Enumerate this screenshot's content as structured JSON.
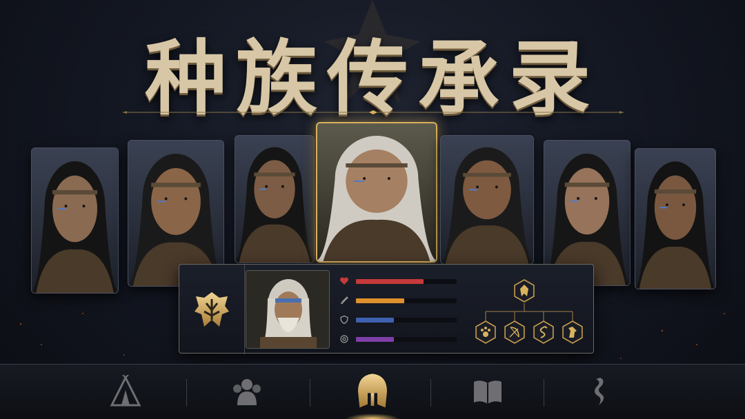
{
  "title": "种族传承录",
  "colors": {
    "gold": "#d9b25e",
    "health": "#c53a3a",
    "attack": "#e0902e",
    "defense": "#3f62b0",
    "magic": "#7e3fa6"
  },
  "portraits": [
    {
      "id": "warrior-woman-1",
      "selected": false
    },
    {
      "id": "warrior-man-topknot",
      "selected": false
    },
    {
      "id": "warrior-woman-braids",
      "selected": false
    },
    {
      "id": "elder-chieftain",
      "selected": true
    },
    {
      "id": "warrior-man-headband",
      "selected": false
    },
    {
      "id": "warrior-woman-jewels",
      "selected": false
    },
    {
      "id": "warrior-man-young",
      "selected": false
    }
  ],
  "stats": [
    {
      "icon": "heart-icon",
      "value": 0.67,
      "color": "#c53a3a"
    },
    {
      "icon": "sword-icon",
      "value": 0.48,
      "color": "#e0902e"
    },
    {
      "icon": "shield-icon",
      "value": 0.38,
      "color": "#3f62b0"
    },
    {
      "icon": "swirl-icon",
      "value": 0.38,
      "color": "#7e3fa6"
    }
  ],
  "skill_tree": {
    "root_icon": "tribal-emblem-icon",
    "children": [
      "paw-icon",
      "bow-icon",
      "serpent-icon",
      "horse-icon"
    ]
  },
  "nav": [
    {
      "icon": "tent-icon",
      "active": false
    },
    {
      "icon": "group-icon",
      "active": false
    },
    {
      "icon": "helmet-icon",
      "active": true
    },
    {
      "icon": "book-icon",
      "active": false
    },
    {
      "icon": "dragon-icon",
      "active": false
    }
  ]
}
